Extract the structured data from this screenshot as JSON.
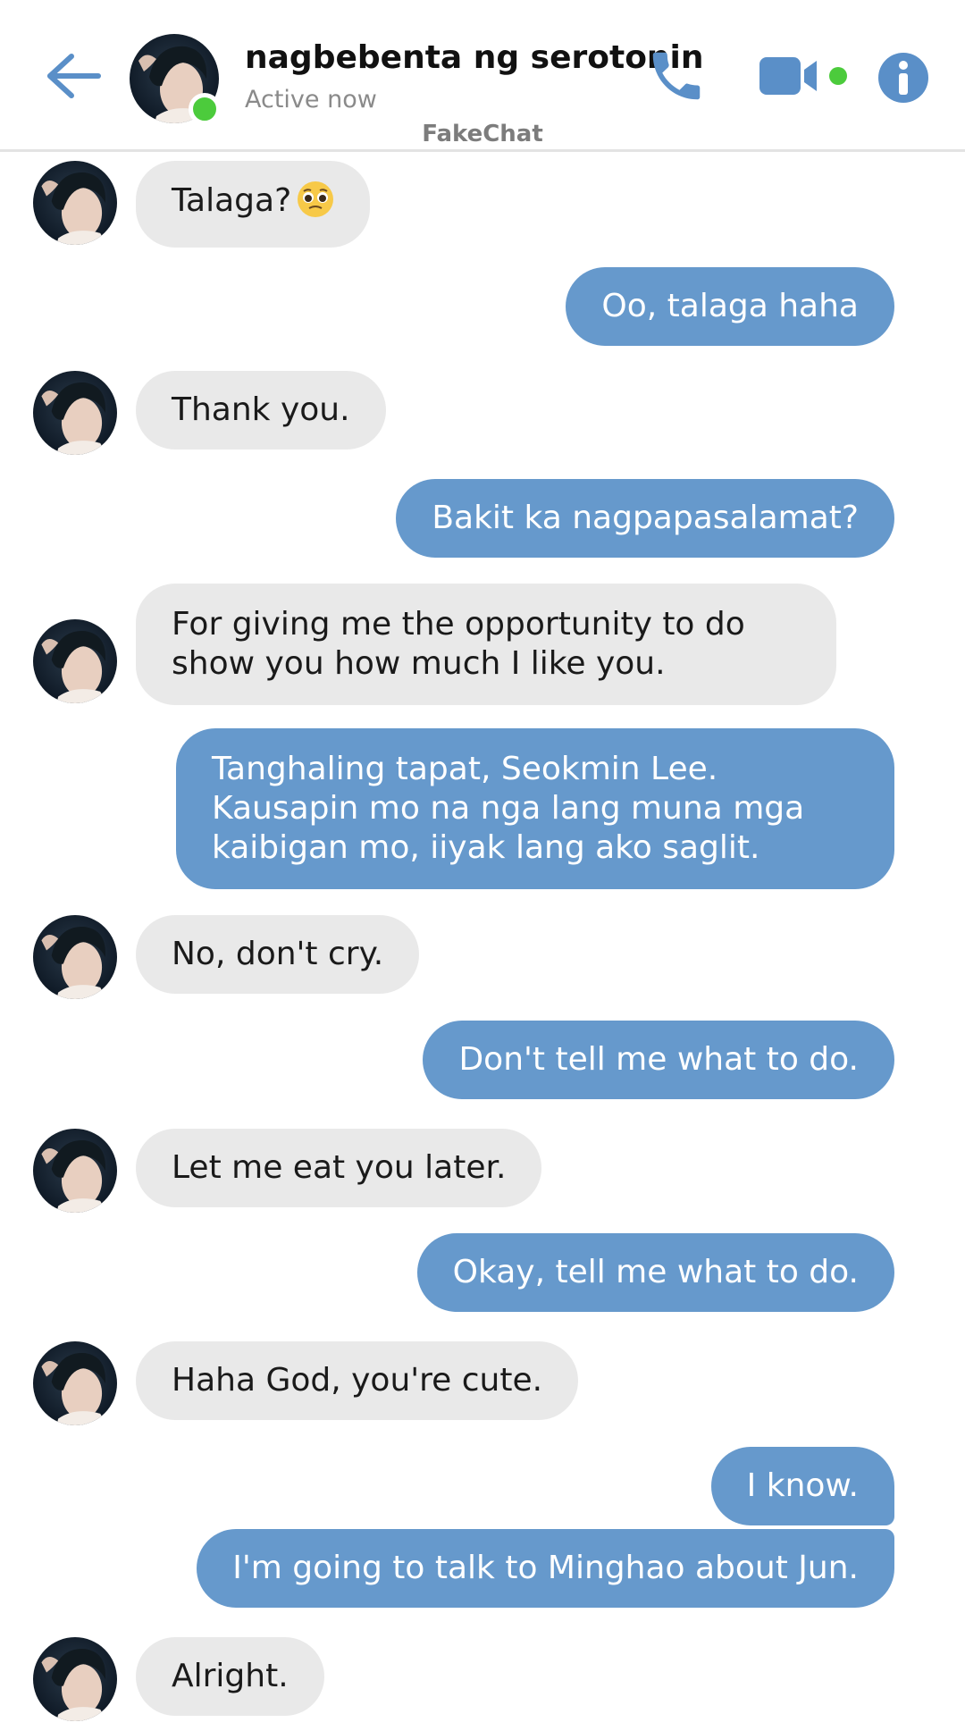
{
  "header": {
    "contact_name": "nagbebenta ng serotonin",
    "status": "Active now",
    "watermark": "FakeChat",
    "back_icon": "back-arrow-icon",
    "call_icon": "phone-icon",
    "video_icon": "video-camera-icon",
    "info_icon": "info-icon"
  },
  "colors": {
    "accent": "#6699cc",
    "incoming_bubble": "#e9e9e9",
    "online": "#4ccb3c"
  },
  "messages": [
    {
      "from": "them",
      "text": "Talaga?",
      "emoji": "pleading-face-emoji"
    },
    {
      "from": "me",
      "text": "Oo, talaga haha"
    },
    {
      "from": "them",
      "text": "Thank you."
    },
    {
      "from": "me",
      "text": "Bakit ka nagpapasalamat?"
    },
    {
      "from": "them",
      "text": "For giving me the opportunity to do show you how much I like you."
    },
    {
      "from": "me",
      "text": "Tanghaling tapat, Seokmin Lee. Kausapin mo na nga lang muna mga kaibigan mo, iiyak lang ako saglit."
    },
    {
      "from": "them",
      "text": "No, don't cry."
    },
    {
      "from": "me",
      "text": "Don't tell me what to do."
    },
    {
      "from": "them",
      "text": "Let me eat you later."
    },
    {
      "from": "me",
      "text": "Okay, tell me what to do."
    },
    {
      "from": "them",
      "text": "Haha God, you're cute."
    },
    {
      "from": "me",
      "text": "I know."
    },
    {
      "from": "me",
      "text": "I'm going to talk to Minghao about Jun."
    },
    {
      "from": "them",
      "text": "Alright."
    }
  ]
}
